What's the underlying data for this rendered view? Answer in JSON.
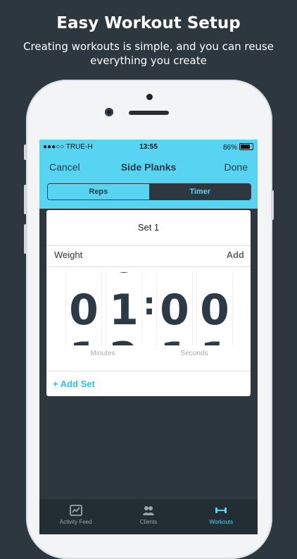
{
  "promo": {
    "headline": "Easy Workout Setup",
    "subline": "Creating workouts is simple, and you can reuse everything you create"
  },
  "status_bar": {
    "carrier": "●●●○○ TRUE-H",
    "time": "13:55",
    "battery": "86%"
  },
  "nav": {
    "cancel_label": "Cancel",
    "title": "Side Planks",
    "done_label": "Done"
  },
  "mode_toggle": {
    "options": [
      "Reps",
      "Timer"
    ],
    "selected": "Reps"
  },
  "set_card": {
    "title": "Set 1",
    "weight_label": "Weight",
    "weight_action": "Add",
    "timer": {
      "digits": [
        "0",
        "1",
        "0",
        "0"
      ],
      "separator": ":",
      "minutes_label": "Minutes",
      "seconds_label": "Seconds"
    },
    "add_set_label": "+ Add Set"
  },
  "tab_bar": {
    "items": [
      {
        "label": "Activity Feed",
        "icon": "activity-chart-icon"
      },
      {
        "label": "Clients",
        "icon": "people-icon"
      },
      {
        "label": "Workouts",
        "icon": "dumbbell-icon"
      }
    ],
    "active": "Workouts"
  },
  "colors": {
    "accent": "#57d4f2",
    "background": "#2c3740",
    "text_dark": "#2b3a46"
  }
}
